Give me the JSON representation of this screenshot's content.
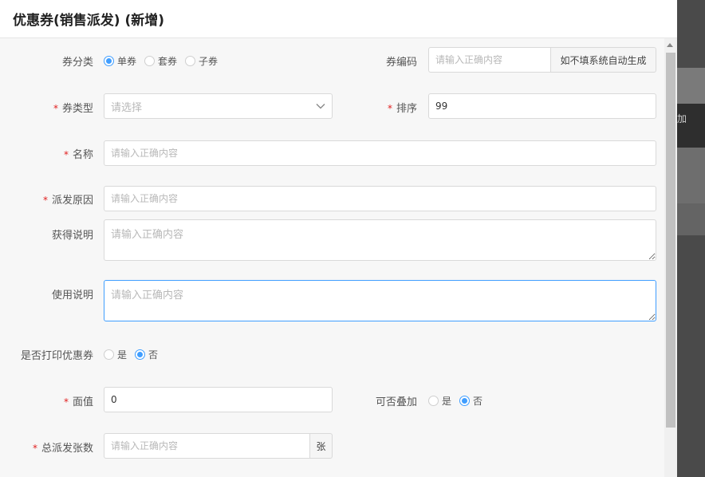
{
  "dialog": {
    "title": "优惠券(销售派发) (新增)"
  },
  "backdrop": {
    "text": "加"
  },
  "form": {
    "coupon_category": {
      "label": "券分类",
      "options": [
        "单券",
        "套券",
        "子券"
      ],
      "selected": "单券"
    },
    "coupon_code": {
      "label": "券编码",
      "placeholder": "请输入正确内容",
      "addon": "如不填系统自动生成"
    },
    "coupon_type": {
      "label": "券类型",
      "placeholder": "请选择"
    },
    "sort": {
      "label": "排序",
      "value": "99"
    },
    "name": {
      "label": "名称",
      "placeholder": "请输入正确内容"
    },
    "dispatch_reason": {
      "label": "派发原因",
      "placeholder": "请输入正确内容"
    },
    "obtain_desc": {
      "label": "获得说明",
      "placeholder": "请输入正确内容"
    },
    "usage_desc": {
      "label": "使用说明",
      "placeholder": "请输入正确内容"
    },
    "print_coupon": {
      "label": "是否打印优惠券",
      "options": [
        "是",
        "否"
      ],
      "selected": "否"
    },
    "face_value": {
      "label": "面值",
      "value": "0"
    },
    "stackable": {
      "label": "可否叠加",
      "options": [
        "是",
        "否"
      ],
      "selected": "否"
    },
    "total_dispatch": {
      "label": "总派发张数",
      "placeholder": "请输入正确内容",
      "unit": "张"
    }
  },
  "required_mark": "*"
}
